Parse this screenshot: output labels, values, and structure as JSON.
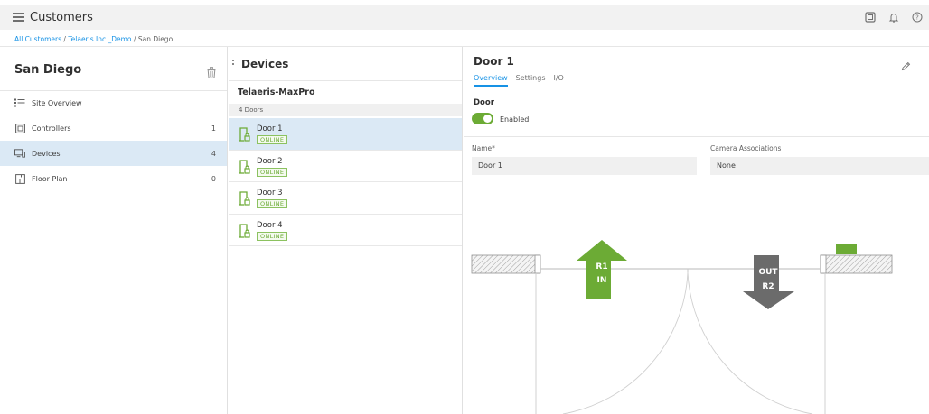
{
  "header": {
    "app_title": "Customers"
  },
  "breadcrumb": {
    "items": [
      "All Customers",
      "Telaeris Inc._Demo",
      "San Diego"
    ],
    "separator": "/"
  },
  "site": {
    "title": "San Diego",
    "nav": [
      {
        "label": "Site Overview",
        "count": "",
        "icon": "list-icon"
      },
      {
        "label": "Controllers",
        "count": "1",
        "icon": "controller-icon"
      },
      {
        "label": "Devices",
        "count": "4",
        "icon": "devices-icon"
      },
      {
        "label": "Floor Plan",
        "count": "0",
        "icon": "floor-plan-icon"
      }
    ]
  },
  "devices": {
    "title": "Devices",
    "group": "Telaeris-MaxPro",
    "group_count": "4  Doors",
    "items": [
      {
        "name": "Door 1",
        "status": "ONLINE"
      },
      {
        "name": "Door 2",
        "status": "ONLINE"
      },
      {
        "name": "Door 3",
        "status": "ONLINE"
      },
      {
        "name": "Door 4",
        "status": "ONLINE"
      }
    ]
  },
  "detail": {
    "title": "Door 1",
    "tabs": [
      "Overview",
      "Settings",
      "I/O"
    ],
    "section_label": "Door",
    "toggle_label": "Enabled",
    "name_label": "Name*",
    "name_value": "Door 1",
    "camera_label": "Camera Associations",
    "camera_value": "None",
    "reader_in_line1": "R1",
    "reader_in_line2": "IN",
    "reader_out_line1": "OUT",
    "reader_out_line2": "R2"
  },
  "colors": {
    "accent": "#1792e5",
    "online": "#6cab35",
    "out_arrow": "#6b6b6b",
    "selected_bg": "#dbe9f5"
  }
}
